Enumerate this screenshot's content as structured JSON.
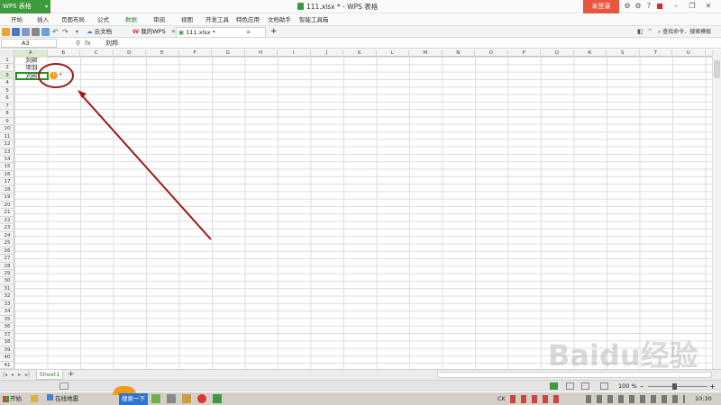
{
  "titlebar": {
    "app_button": "WPS 表格",
    "doc_title": "111.xlsx * - WPS 表格",
    "login": "未登录"
  },
  "menu": [
    "开始",
    "插入",
    "页面布局",
    "公式",
    "数据",
    "审阅",
    "视图",
    "开发工具",
    "特色应用",
    "文档助手",
    "智能工具箱"
  ],
  "toolbar": {
    "tabs": [
      "云文档",
      "我的WPS",
      "111.xlsx *"
    ],
    "search": "查找命令、搜索模板"
  },
  "formula": {
    "cell_ref": "A3",
    "fx": "fx",
    "value": "刘邦"
  },
  "columns": [
    "A",
    "B",
    "C",
    "D",
    "E",
    "F",
    "G",
    "H",
    "I",
    "J",
    "K",
    "L",
    "M",
    "N",
    "O",
    "P",
    "Q",
    "R",
    "S",
    "T",
    "U"
  ],
  "rows": [
    "1",
    "2",
    "3",
    "4",
    "5",
    "6",
    "7",
    "8",
    "9",
    "10",
    "11",
    "12",
    "13",
    "14",
    "15",
    "16",
    "17",
    "18",
    "19",
    "20",
    "21",
    "22",
    "23",
    "24",
    "25",
    "26",
    "27",
    "28",
    "29",
    "30",
    "31",
    "32",
    "33",
    "34",
    "35",
    "36",
    "37",
    "38",
    "39",
    "40",
    "41"
  ],
  "cells": {
    "A1": "刘邦",
    "A2": "项羽",
    "A3": "刘邦"
  },
  "sheet": {
    "name": "Sheet1",
    "add": "+"
  },
  "status": {
    "zoom": "100 %"
  },
  "taskbar": {
    "start": "开始",
    "task1": "在线地震",
    "task2": "搜索一下",
    "ime": "CK",
    "clock": "10:30"
  },
  "watermark": "Baidu经验",
  "colors": {
    "accent": "#3d9a3d",
    "login": "#e9563f",
    "annotation": "#9b1b1b"
  }
}
